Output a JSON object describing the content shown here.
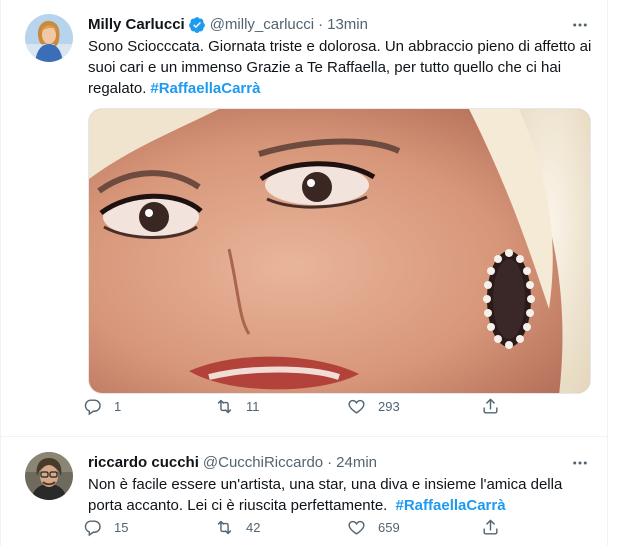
{
  "tweets": [
    {
      "author": {
        "name": "Milly Carlucci",
        "handle": "@milly_carlucci",
        "verified": true
      },
      "separator": "·",
      "time": "13min",
      "text_before": "Sono Sciocccata. Giornata triste e dolorosa. Un abbraccio pieno di affetto ai suoi cari e un immenso Grazie a Te Raffaella, per tutto quello che ci hai regalato.",
      "text_before_exact": "Sono Sciocccata.",
      "hashtag": "#RaffaellaCarrà",
      "stats": {
        "replies": "1",
        "retweets": "11",
        "likes": "293"
      }
    },
    {
      "author": {
        "name": "riccardo cucchi",
        "handle": "@CucchiRiccardo",
        "verified": false
      },
      "separator": "·",
      "time": "24min",
      "text_before": "Non è facile essere un'artista, una star, una diva e insieme l'amica della porta accanto. Lei ci è riuscita perfettamente.",
      "hashtag": "#RaffaellaCarrà",
      "stats": {
        "replies": "15",
        "retweets": "42",
        "likes": "659"
      }
    }
  ],
  "icons": {
    "verified": "verified-badge-icon",
    "more": "more-dots-icon",
    "reply": "reply-icon",
    "retweet": "retweet-icon",
    "like": "heart-icon",
    "share": "share-icon"
  },
  "colors": {
    "accent": "#1d9bf0",
    "secondary_text": "#536471",
    "divider": "#eff3f4"
  }
}
